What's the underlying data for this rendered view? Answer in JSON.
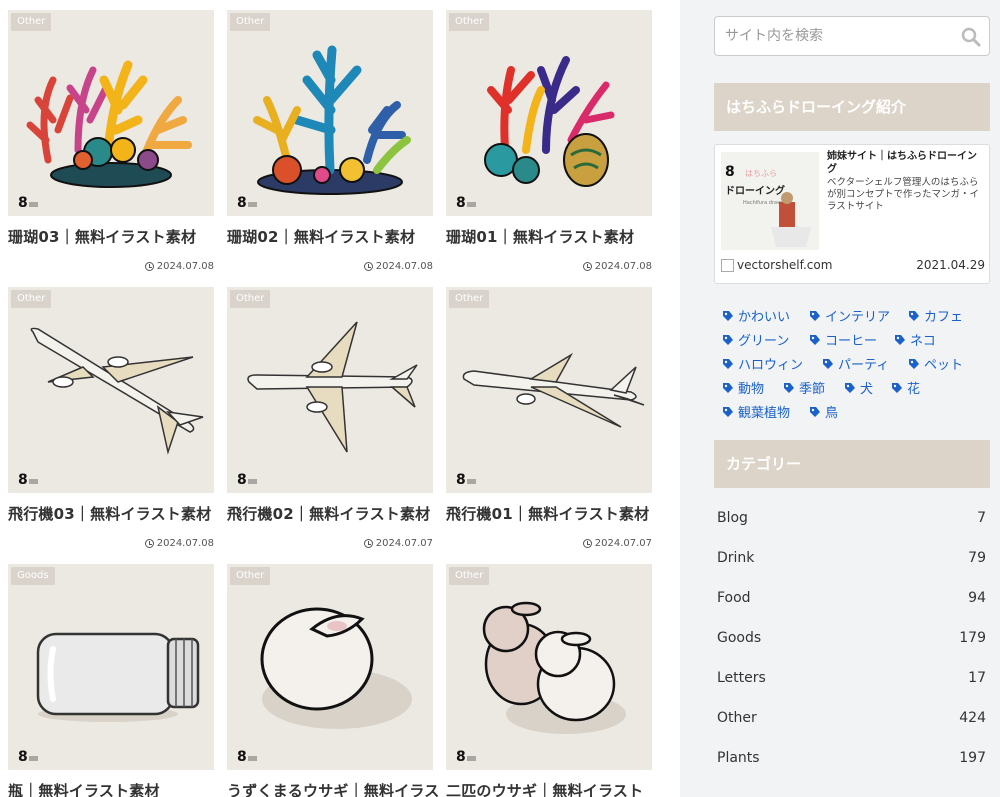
{
  "posts": [
    {
      "category": "Other",
      "title": "珊瑚03｜無料イラスト素材",
      "date": "2024.07.08"
    },
    {
      "category": "Other",
      "title": "珊瑚02｜無料イラスト素材",
      "date": "2024.07.08"
    },
    {
      "category": "Other",
      "title": "珊瑚01｜無料イラスト素材",
      "date": "2024.07.08"
    },
    {
      "category": "Other",
      "title": "飛行機03｜無料イラスト素材",
      "date": "2024.07.08"
    },
    {
      "category": "Other",
      "title": "飛行機02｜無料イラスト素材",
      "date": "2024.07.07"
    },
    {
      "category": "Other",
      "title": "飛行機01｜無料イラスト素材",
      "date": "2024.07.07"
    },
    {
      "category": "Goods",
      "title": "瓶｜無料イラスト素材",
      "date": ""
    },
    {
      "category": "Other",
      "title": "うずくまるウサギ｜無料イラス",
      "date": ""
    },
    {
      "category": "Other",
      "title": "二匹のウサギ｜無料イラスト",
      "date": ""
    }
  ],
  "sidebar": {
    "search_placeholder": "サイト内を検索",
    "intro_widget_title": "はちふらドローイング紹介",
    "blogcard": {
      "title": "姉妹サイト｜はちふらドローイング",
      "description": "ベクターシェルフ管理人のはちふらが別コンセプトで作ったマンガ・イラストサイト",
      "thumb_small": "はちふら",
      "thumb_big": "ドローイング",
      "thumb_sub": "Hachifura drawing",
      "site": "vectorshelf.com",
      "date": "2021.04.29"
    },
    "tags": [
      "かわいい",
      "インテリア",
      "カフェ",
      "グリーン",
      "コーヒー",
      "ネコ",
      "ハロウィン",
      "パーティ",
      "ペット",
      "動物",
      "季節",
      "犬",
      "花",
      "観葉植物",
      "鳥"
    ],
    "category_widget_title": "カテゴリー",
    "categories": [
      {
        "name": "Blog",
        "count": "7"
      },
      {
        "name": "Drink",
        "count": "79"
      },
      {
        "name": "Food",
        "count": "94"
      },
      {
        "name": "Goods",
        "count": "179"
      },
      {
        "name": "Letters",
        "count": "17"
      },
      {
        "name": "Other",
        "count": "424"
      },
      {
        "name": "Plants",
        "count": "197"
      }
    ]
  },
  "colors": {
    "accent": "#dcd4c8",
    "tag_link": "#1a62c9",
    "thumb_bg": "#ece8e2"
  }
}
